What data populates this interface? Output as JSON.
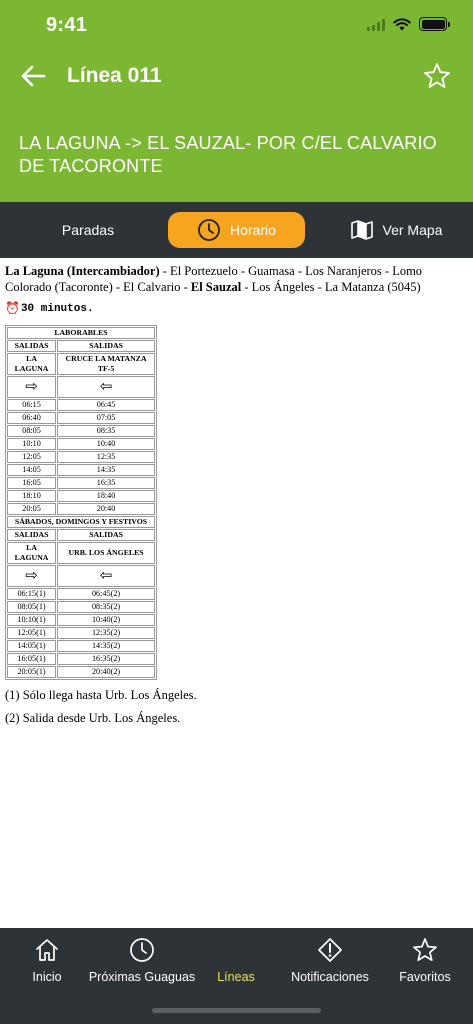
{
  "status_bar": {
    "time": "9:41"
  },
  "header": {
    "title": "Línea 011",
    "route": "LA LAGUNA -> EL SAUZAL- POR C/EL CALVARIO DE TACORONTE"
  },
  "tabs": {
    "paradas": "Paradas",
    "horario": "Horario",
    "mapa": "Ver Mapa"
  },
  "content": {
    "stops": [
      {
        "text": "La Laguna (Intercambiador)",
        "bold": true
      },
      {
        "text": " - El Portezuelo - Guamasa - Los Naranjeros - Lomo Colorado (Tacoronte) - El Calvario - ",
        "bold": false
      },
      {
        "text": "El Sauzal",
        "bold": true
      },
      {
        "text": " - Los Ángeles - La Matanza (5045)",
        "bold": false
      }
    ],
    "frequency": "30 minutos.",
    "weekday": {
      "title": "LABORABLES",
      "col1_header": "SALIDAS",
      "col2_header": "SALIDAS",
      "col1_origin": "LA LAGUNA",
      "col2_origin": "CRUCE LA MATANZA TF-5",
      "rows": [
        [
          "06:15",
          "06:45"
        ],
        [
          "06:40",
          "07:05"
        ],
        [
          "08:05",
          "08:35"
        ],
        [
          "10:10",
          "10:40"
        ],
        [
          "12:05",
          "12:35"
        ],
        [
          "14:05",
          "14:35"
        ],
        [
          "16:05",
          "16:35"
        ],
        [
          "18:10",
          "18:40"
        ],
        [
          "20:05",
          "20:40"
        ]
      ]
    },
    "weekend": {
      "title": "SÁBADOS, DOMINGOS Y FESTIVOS",
      "col1_header": "SALIDAS",
      "col2_header": "SALIDAS",
      "col1_origin": "LA LAGUNA",
      "col2_origin": "URB. LOS ÁNGELES",
      "rows": [
        [
          "06:15(1)",
          "06:45(2)"
        ],
        [
          "08:05(1)",
          "08:35(2)"
        ],
        [
          "10:10(1)",
          "10:40(2)"
        ],
        [
          "12:05(1)",
          "12:35(2)"
        ],
        [
          "14:05(1)",
          "14:35(2)"
        ],
        [
          "16:05(1)",
          "16:35(2)"
        ],
        [
          "20:05(1)",
          "20:40(2)"
        ]
      ]
    },
    "notes": [
      "(1) Sólo llega hasta Urb. Los Ángeles.",
      "(2) Salida desde Urb. Los Ángeles."
    ]
  },
  "bottom_nav": [
    {
      "key": "inicio",
      "label": "Inicio",
      "icon": "home-icon",
      "active": false
    },
    {
      "key": "proximas",
      "label": "Próximas Guaguas",
      "icon": "clock-icon",
      "active": false
    },
    {
      "key": "lineas",
      "label": "Líneas",
      "icon": "bus-lines-icon",
      "active": true
    },
    {
      "key": "notificaciones",
      "label": "Notificaciones",
      "icon": "alert-icon",
      "active": false
    },
    {
      "key": "favoritos",
      "label": "Favoritos",
      "icon": "star-icon",
      "active": false
    }
  ],
  "colors": {
    "header_green": "#7cb733",
    "dark_bar": "#2e3338",
    "active_tab_orange": "#f7a521",
    "active_nav_yellow": "#e6e14b"
  }
}
